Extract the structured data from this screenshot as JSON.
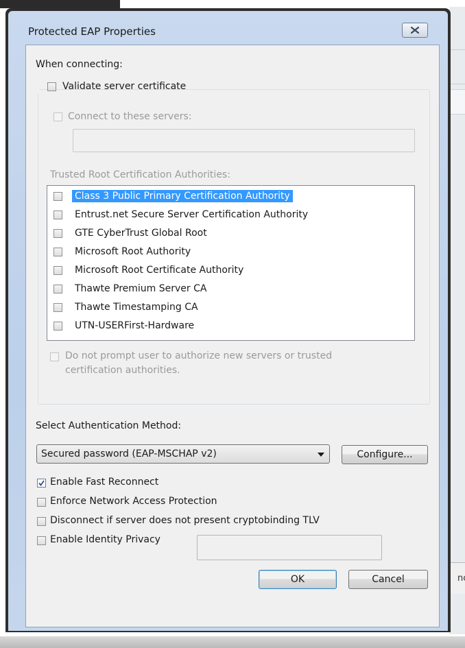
{
  "background": {
    "right_fragment_text": "nc"
  },
  "dialog": {
    "title": "Protected EAP Properties",
    "close_label": "close"
  },
  "connecting": {
    "heading": "When connecting:",
    "validate_cert_label": "Validate server certificate",
    "validate_cert_checked": false,
    "connect_servers_label": "Connect to these servers:",
    "servers_value": "",
    "trusted_root_label": "Trusted Root Certification Authorities:",
    "authorities": [
      {
        "label": "Class 3 Public Primary Certification Authority",
        "checked": false,
        "selected": true
      },
      {
        "label": "Entrust.net Secure Server Certification Authority",
        "checked": false,
        "selected": false
      },
      {
        "label": "GTE CyberTrust Global Root",
        "checked": false,
        "selected": false
      },
      {
        "label": "Microsoft Root Authority",
        "checked": false,
        "selected": false
      },
      {
        "label": "Microsoft Root Certificate Authority",
        "checked": false,
        "selected": false
      },
      {
        "label": "Thawte Premium Server CA",
        "checked": false,
        "selected": false
      },
      {
        "label": "Thawte Timestamping CA",
        "checked": false,
        "selected": false
      },
      {
        "label": "UTN-USERFirst-Hardware",
        "checked": false,
        "selected": false
      }
    ],
    "do_not_prompt_line1": "Do not prompt user to authorize new servers or trusted",
    "do_not_prompt_line2": "certification authorities."
  },
  "auth": {
    "heading": "Select Authentication Method:",
    "method_selected": "Secured password (EAP-MSCHAP v2)",
    "configure_label": "Configure...",
    "enable_fast_reconnect_label": "Enable Fast Reconnect",
    "enable_fast_reconnect_checked": true,
    "enforce_nap_label": "Enforce Network Access Protection",
    "enforce_nap_checked": false,
    "disconnect_label": "Disconnect if server does not present cryptobinding TLV",
    "disconnect_checked": false,
    "identity_privacy_label": "Enable Identity Privacy",
    "identity_privacy_checked": false,
    "identity_value": ""
  },
  "buttons": {
    "ok_label": "OK",
    "cancel_label": "Cancel"
  },
  "colors": {
    "selection": "#3399ff",
    "frame": "#bcd0ea",
    "client": "#f0f0f0"
  }
}
